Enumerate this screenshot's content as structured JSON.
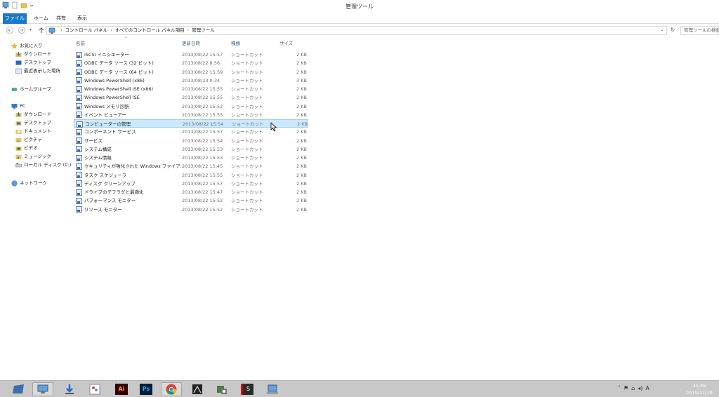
{
  "window": {
    "title": "管理ツール"
  },
  "ribbon": {
    "tabs": [
      "ファイル",
      "ホーム",
      "共有",
      "表示"
    ]
  },
  "address": {
    "breadcrumb": [
      "コントロール パネル",
      "すべてのコントロール パネル項目",
      "管理ツール"
    ],
    "search_placeholder": "管理ツールの検索"
  },
  "nav": {
    "favorites_label": "お気に入り",
    "favorites": [
      "ダウンロード",
      "デスクトップ",
      "最近表示した場所"
    ],
    "homegroup": "ホームグループ",
    "pc_label": "PC",
    "pc_items": [
      "ダウンロード",
      "デスクトップ",
      "ドキュメント",
      "ピクチャ",
      "ビデオ",
      "ミュージック",
      "ローカル ディスク (C:)"
    ],
    "network": "ネットワーク"
  },
  "columns": {
    "name": "名前",
    "date": "更新日時",
    "type": "種類",
    "size": "サイズ"
  },
  "files": [
    {
      "name": "iSCSI イニシエーター",
      "date": "2013/08/22 15:57",
      "type": "ショートカット",
      "size": "2 KB"
    },
    {
      "name": "ODBC データ ソース (32 ビット)",
      "date": "2013/08/22 8:56",
      "type": "ショートカット",
      "size": "2 KB"
    },
    {
      "name": "ODBC データ ソース (64 ビット)",
      "date": "2013/08/22 15:59",
      "type": "ショートカット",
      "size": "2 KB"
    },
    {
      "name": "Windows PowerShell (x86)",
      "date": "2013/08/23 0:34",
      "type": "ショートカット",
      "size": "3 KB"
    },
    {
      "name": "Windows PowerShell ISE (x86)",
      "date": "2013/08/22 15:55",
      "type": "ショートカット",
      "size": "2 KB"
    },
    {
      "name": "Windows PowerShell ISE",
      "date": "2013/08/22 15:55",
      "type": "ショートカット",
      "size": "2 KB"
    },
    {
      "name": "Windows メモリ診断",
      "date": "2013/08/22 15:52",
      "type": "ショートカット",
      "size": "2 KB"
    },
    {
      "name": "イベント ビューアー",
      "date": "2013/08/22 15:55",
      "type": "ショートカット",
      "size": "2 KB"
    },
    {
      "name": "コンピューターの管理",
      "date": "2013/08/22 15:54",
      "type": "ショートカット",
      "size": "2 KB"
    },
    {
      "name": "コンポーネント サービス",
      "date": "2013/08/22 15:57",
      "type": "ショートカット",
      "size": "2 KB"
    },
    {
      "name": "サービス",
      "date": "2013/08/22 15:54",
      "type": "ショートカット",
      "size": "2 KB"
    },
    {
      "name": "システム構成",
      "date": "2013/08/22 15:53",
      "type": "ショートカット",
      "size": "2 KB"
    },
    {
      "name": "システム情報",
      "date": "2013/08/22 15:53",
      "type": "ショートカット",
      "size": "2 KB"
    },
    {
      "name": "セキュリティが強化された Windows ファイア...",
      "date": "2013/08/22 15:45",
      "type": "ショートカット",
      "size": "2 KB"
    },
    {
      "name": "タスク スケジューラ",
      "date": "2013/08/22 15:55",
      "type": "ショートカット",
      "size": "2 KB"
    },
    {
      "name": "ディスク クリーンアップ",
      "date": "2013/08/22 15:57",
      "type": "ショートカット",
      "size": "2 KB"
    },
    {
      "name": "ドライブのデフラグと最適化",
      "date": "2013/08/22 15:47",
      "type": "ショートカット",
      "size": "2 KB"
    },
    {
      "name": "パフォーマンス モニター",
      "date": "2013/08/22 15:52",
      "type": "ショートカット",
      "size": "2 KB"
    },
    {
      "name": "リソース モニター",
      "date": "2013/08/22 15:52",
      "type": "ショートカット",
      "size": "2 KB"
    }
  ],
  "selected_index": 8,
  "taskbar": {
    "apps": [
      "start-icon",
      "control-panel-icon",
      "downloads-icon",
      "paint-icon",
      "illustrator-icon",
      "photoshop-icon",
      "chrome-icon",
      "media-icon",
      "security-icon",
      "s-app-icon",
      "network-admin-icon"
    ],
    "illustrator_label": "Ai",
    "photoshop_label": "Ps",
    "s_label": "S",
    "ime_label": "A",
    "time": "21:46",
    "date": "2019/11/19"
  },
  "colors": {
    "accent": "#1979ca",
    "selection": "#cce8ff",
    "selection_border": "#99d1ff",
    "taskbar": "#c8c8c8"
  }
}
